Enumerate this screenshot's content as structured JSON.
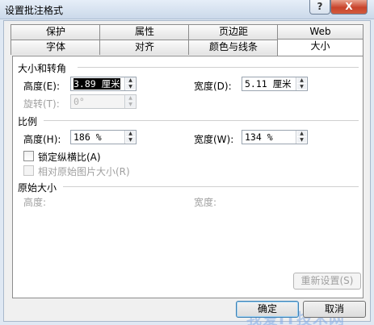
{
  "window": {
    "title": "设置批注格式",
    "help_label": "?",
    "close_label": "X"
  },
  "tabs_back": [
    "保护",
    "属性",
    "页边距",
    "Web"
  ],
  "tabs_front": [
    "字体",
    "对齐",
    "颜色与线条",
    "大小"
  ],
  "size_rotate": {
    "heading": "大小和转角",
    "height_label": "高度(E):",
    "height_value": "3.89",
    "height_unit": " 厘米",
    "width_label": "宽度(D):",
    "width_value": "5.11 厘米",
    "rotate_label": "旋转(T):",
    "rotate_value": "0°"
  },
  "scale": {
    "heading": "比例",
    "height_label": "高度(H):",
    "height_value": "186 %",
    "width_label": "宽度(W):",
    "width_value": "134 %",
    "lock_label": "锁定纵横比(A)",
    "relative_label": "相对原始图片大小(R)"
  },
  "original": {
    "heading": "原始大小",
    "height_label": "高度:",
    "width_label": "宽度:"
  },
  "buttons": {
    "reset": "重新设置(S)",
    "ok": "确定",
    "cancel": "取消"
  },
  "watermark": "我爱IT技术网"
}
